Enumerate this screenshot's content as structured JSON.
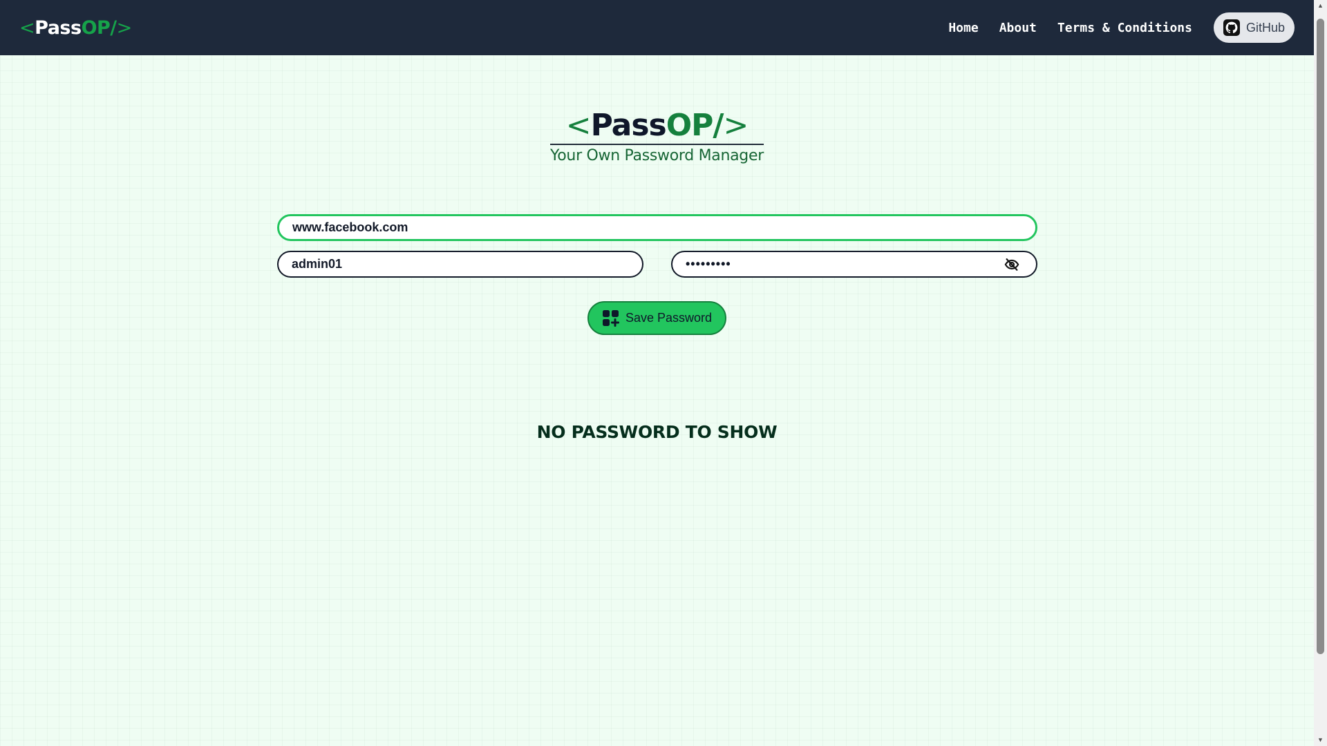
{
  "navbar": {
    "brand": {
      "open": "<",
      "pass": "Pass",
      "op": "OP/",
      "close": ">"
    },
    "links": {
      "home": "Home",
      "about": "About",
      "terms": "Terms & Conditions"
    },
    "github_label": "GitHub",
    "background_color": "#1e293b"
  },
  "hero": {
    "logo": {
      "open": "<",
      "pass": "Pass",
      "op": "OP/",
      "close": ">"
    },
    "tagline": "Your Own Password Manager"
  },
  "form": {
    "site_value": "www.facebook.com",
    "username_value": "admin01",
    "password_masked": "•••••••••",
    "eye_icon": "eye-slash-icon",
    "save_label": "Save Password",
    "save_icon": "grid-add-icon"
  },
  "passwords": {
    "empty_message": "NO PASSWORD TO SHOW"
  },
  "colors": {
    "accent": "#22c55e",
    "accent_dark": "#16a34a",
    "page_bg": "#effdf3"
  }
}
